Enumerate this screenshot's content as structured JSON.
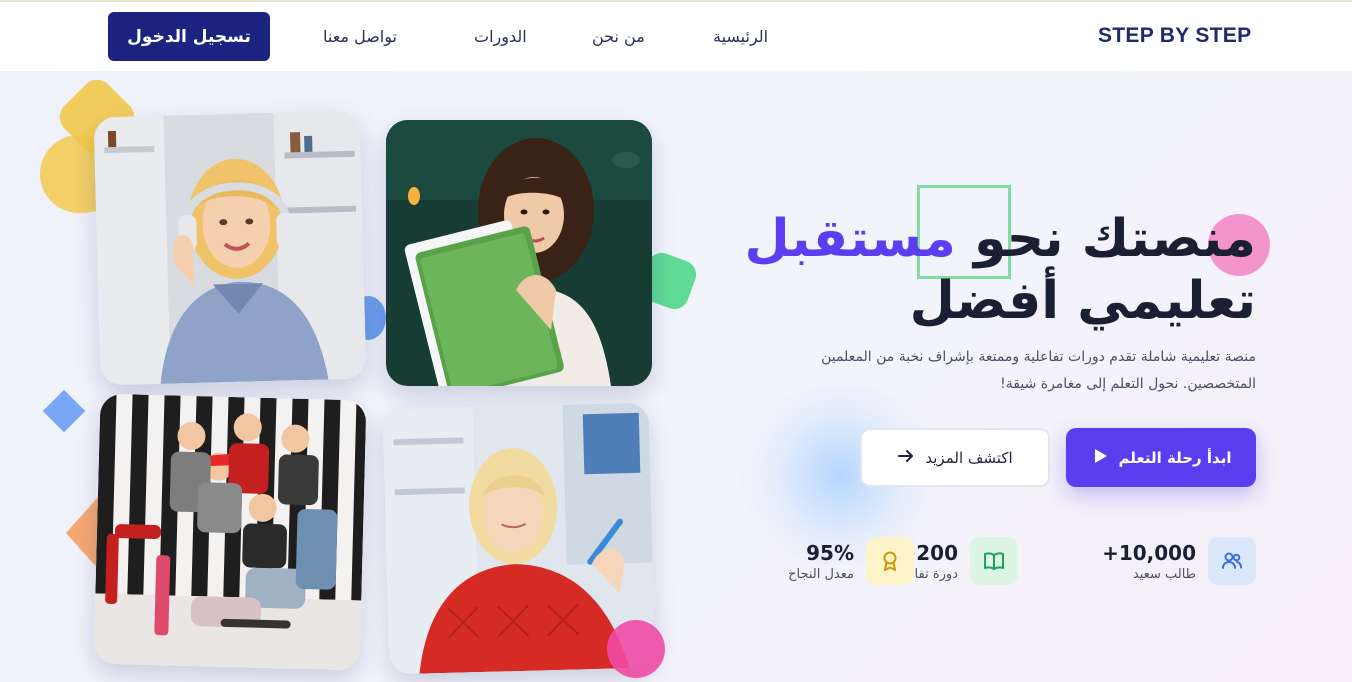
{
  "nav": {
    "brand": "STEP BY STEP",
    "links": [
      "الرئيسية",
      "من نحن",
      "الدورات",
      "تواصل معنا"
    ],
    "login_label": "تسجيل الدخول"
  },
  "hero": {
    "title_part1": "منصتك نحو ",
    "title_accent": "مستقبل",
    "title_line2": "تعليمي أفضل",
    "description": "منصة تعليمية شاملة تقدم دورات تفاعلية وممتعة بإشراف نخبة من المعلمين المتخصصين. نحول التعلم إلى مغامرة شيقة!",
    "primary_button": "ابدأ رحلة التعلم",
    "secondary_button": "اكتشف المزيد"
  },
  "stats": [
    {
      "value": "+10,000",
      "label": "طالب سعيد",
      "icon": "users-icon",
      "color": "#3b6fd8"
    },
    {
      "value": "+200",
      "label": "دورة تفاعلية",
      "icon": "book-icon",
      "color": "#1aa65a"
    },
    {
      "value": "95%",
      "label": "معدل النجاح",
      "icon": "award-icon",
      "color": "#c99a0a"
    }
  ],
  "colors": {
    "brand": "#1e2a6b",
    "login_button": "#1c2380",
    "accent": "#5c3df0",
    "primary_button": "#5b3df0"
  }
}
